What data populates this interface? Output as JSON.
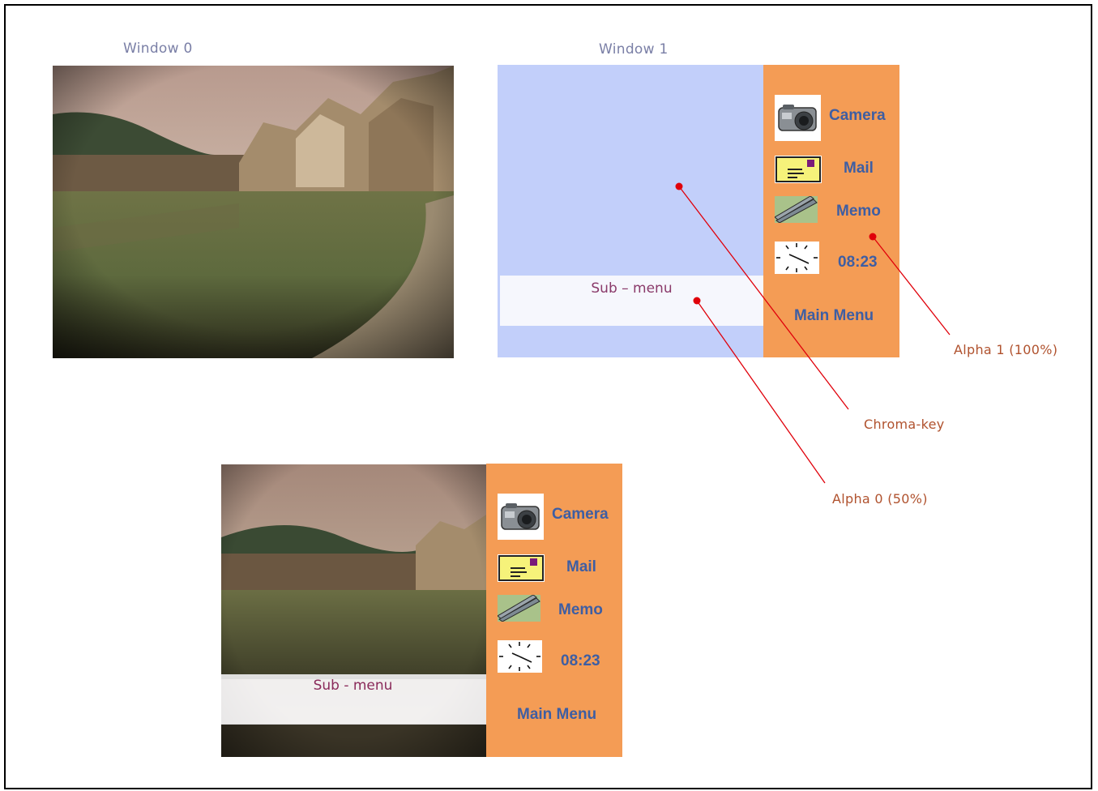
{
  "windows": {
    "window0_title": "Window 0",
    "window1_title": "Window 1"
  },
  "menu": {
    "camera": "Camera",
    "mail": "Mail",
    "memo": "Memo",
    "time": "08:23",
    "main_menu": "Main Menu"
  },
  "submenu": {
    "label": "Sub – menu",
    "label_composite": "Sub - menu"
  },
  "callouts": {
    "alpha1": "Alpha 1 (100%)",
    "chroma": "Chroma-key",
    "alpha0": "Alpha 0 (50%)"
  },
  "colors": {
    "chroma_blue": "#c2cffa",
    "panel_orange": "#f49c55",
    "label_blue": "#3e5ea3",
    "callout_red": "#e0000a"
  },
  "icons": [
    "camera-icon",
    "mail-icon",
    "memo-pen-icon",
    "clock-icon"
  ]
}
